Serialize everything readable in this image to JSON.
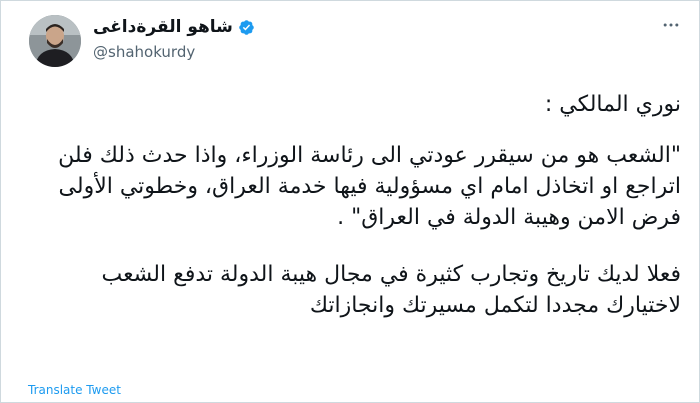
{
  "tweet": {
    "display_name": "شاهو القرةداغی",
    "handle": "@shahokurdy",
    "verified": true,
    "more_icon": "more-horizontal-icon",
    "paragraphs": [
      "نوري المالكي :",
      "\"الشعب هو من سيقرر عودتي الى رئاسة الوزراء، واذا حدث ذلك فلن اتراجع او اتخاذل امام اي مسؤولية فيها خدمة العراق، وخطوتي الأولى فرض الامن وهيبة الدولة في العراق\" .",
      "فعلا لديك تاريخ وتجارب كثيرة في مجال هيبة الدولة تدفع الشعب لاختيارك مجددا لتكمل مسيرتك وانجازاتك"
    ],
    "translate_label": "Translate Tweet",
    "accent_color": "#1d9bf0"
  }
}
